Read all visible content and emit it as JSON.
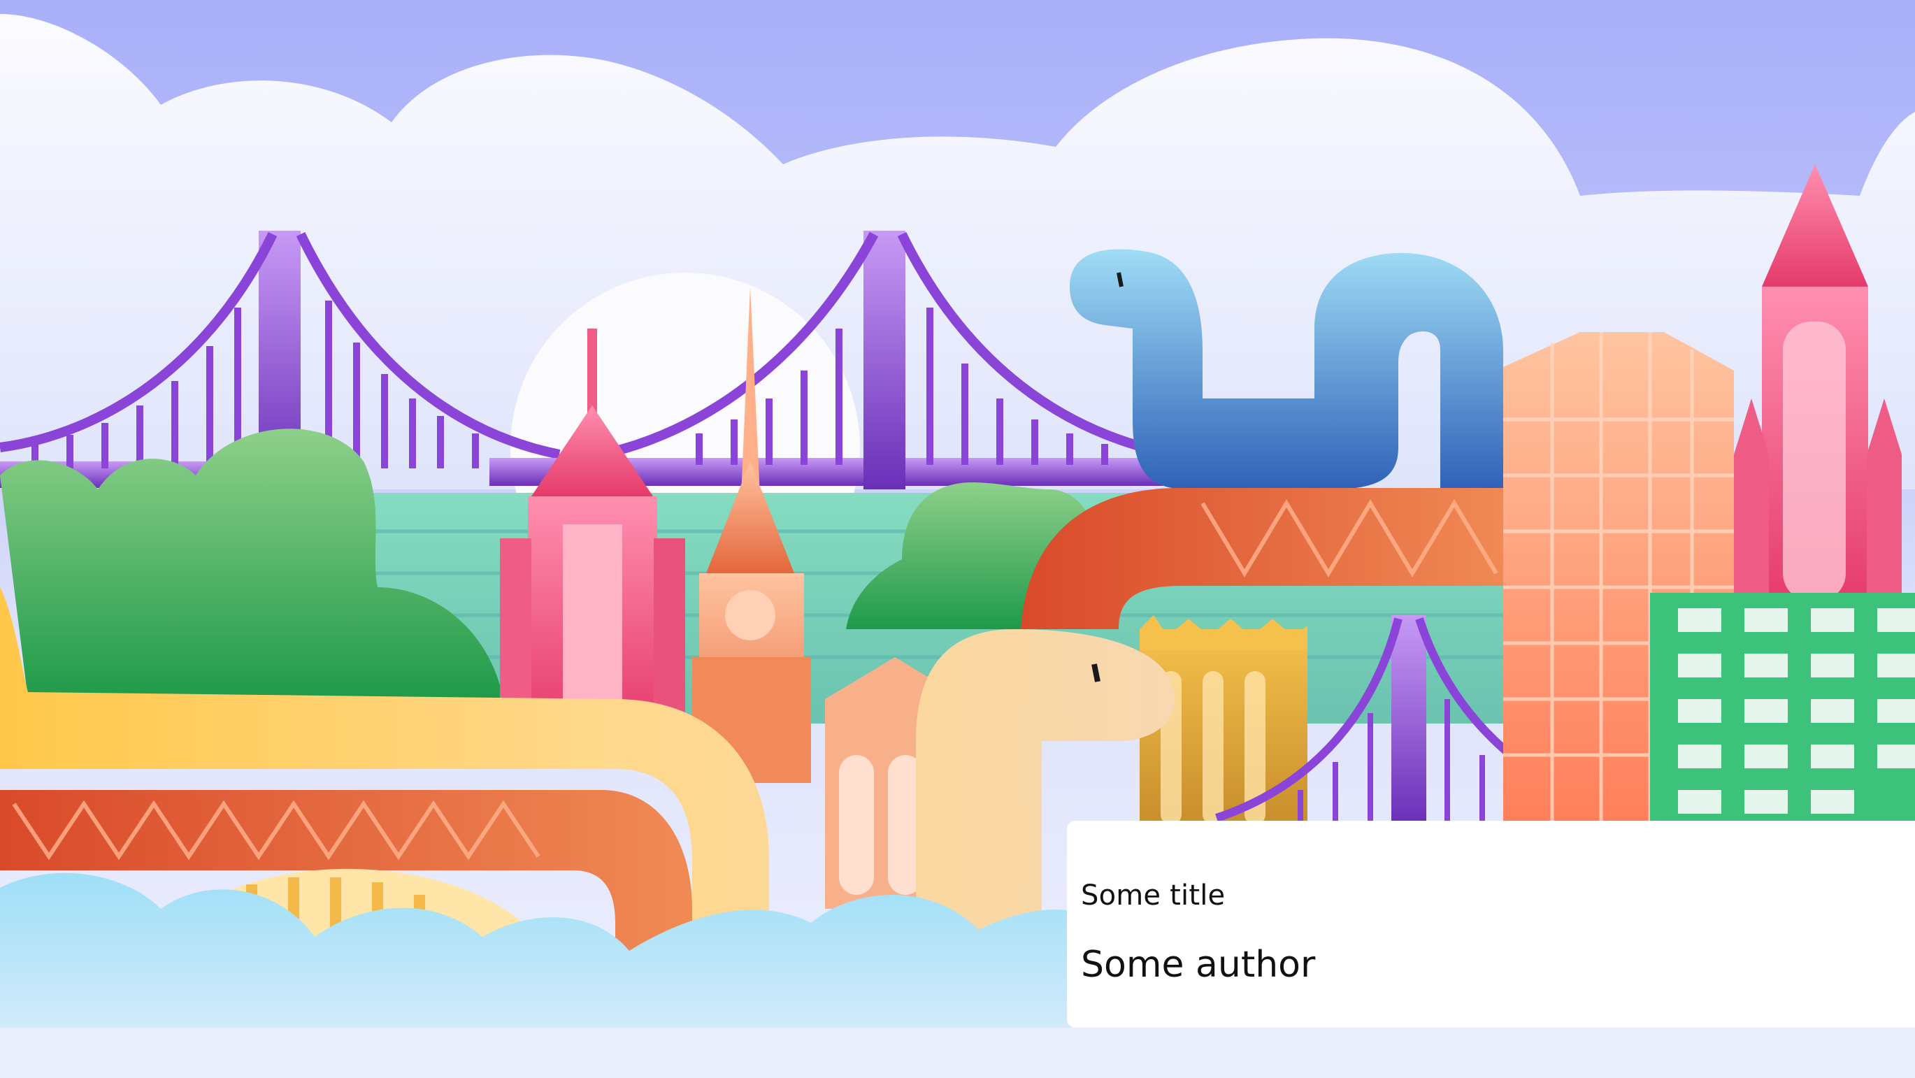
{
  "card": {
    "title": "Some title",
    "author": "Some author"
  },
  "colors": {
    "sky_top": "#a9b0f9",
    "sky_mid": "#c9cffb",
    "cloud": "#f3f4fc",
    "bridge_purple": "#8a45d8",
    "water": "#7fd1b8",
    "tree_green": "#3fa85a",
    "pink_tower": "#ef5d86",
    "orange_arch": "#e46a3c",
    "serpent_blue": "#5aa5e8",
    "serpent_yellow": "#ffd27a",
    "foreground_clouds": "#a8dff5",
    "green_building": "#3cc27a",
    "peach_building": "#ff9f7a"
  }
}
